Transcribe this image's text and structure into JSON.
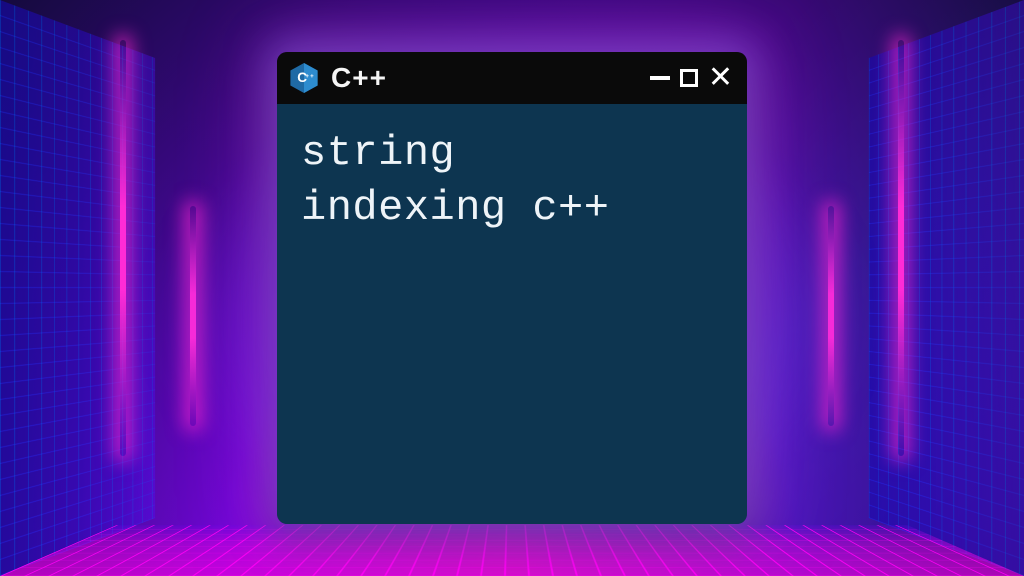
{
  "window": {
    "icon_label": "C++",
    "title": "C++",
    "controls": {
      "minimize": "minimize",
      "maximize": "maximize",
      "close": "close"
    }
  },
  "content": {
    "code_text": "string\nindexing c++"
  },
  "colors": {
    "titlebar_bg": "#0a0a0a",
    "content_bg": "#0d3550",
    "code_fg": "#eef4f8",
    "cpp_icon_bg": "#1f6aa5",
    "cpp_icon_fg": "#ffffff"
  }
}
